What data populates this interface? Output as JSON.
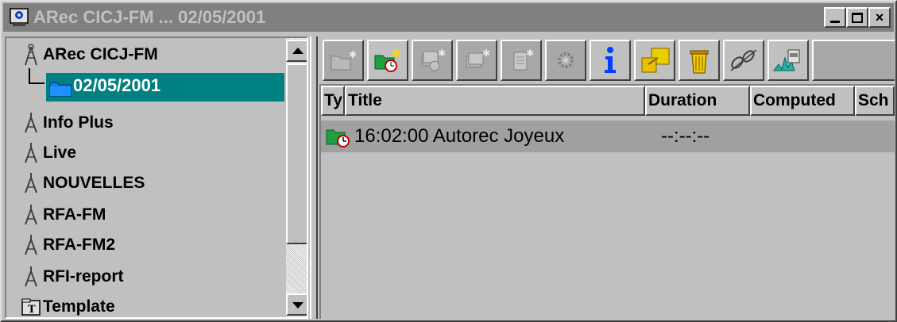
{
  "window": {
    "title": "ARec CICJ-FM ... 02/05/2001",
    "controls": {
      "minimize": "_",
      "maximize": "□",
      "close": "×"
    }
  },
  "tree": {
    "root": {
      "label": "ARec CICJ-FM",
      "icon": "antenna-icon"
    },
    "selected_child": {
      "label": "02/05/2001",
      "icon": "folder-icon"
    },
    "items": [
      {
        "label": "Info Plus",
        "icon": "antenna-icon"
      },
      {
        "label": "Live",
        "icon": "antenna-icon"
      },
      {
        "label": "NOUVELLES",
        "icon": "antenna-icon"
      },
      {
        "label": "RFA-FM",
        "icon": "antenna-icon"
      },
      {
        "label": "RFA-FM2",
        "icon": "antenna-icon"
      },
      {
        "label": "RFI-report",
        "icon": "antenna-icon"
      },
      {
        "label": "Template",
        "icon": "template-icon"
      }
    ]
  },
  "toolbar": {
    "buttons": [
      {
        "name": "new-folder",
        "icon": "new-folder-icon"
      },
      {
        "name": "new-scheduled-folder",
        "icon": "new-scheduled-folder-icon"
      },
      {
        "name": "new-scheduled-item",
        "icon": "new-scheduled-item-icon"
      },
      {
        "name": "new-item",
        "icon": "new-item-icon"
      },
      {
        "name": "new-document",
        "icon": "new-document-icon"
      },
      {
        "name": "settings",
        "icon": "gear-icon"
      },
      {
        "name": "info",
        "icon": "info-icon"
      },
      {
        "name": "move",
        "icon": "move-icon"
      },
      {
        "name": "delete",
        "icon": "trash-icon"
      },
      {
        "name": "link",
        "icon": "link-icon"
      },
      {
        "name": "audio-edit",
        "icon": "waveform-icon"
      }
    ]
  },
  "list": {
    "columns": [
      "Ty",
      "Title",
      "Duration",
      "Computed",
      "Sch"
    ],
    "rows": [
      {
        "title": "16:02:00 Autorec Joyeux",
        "duration": "--:--:--",
        "icon": "scheduled-folder-icon"
      }
    ]
  },
  "colors": {
    "selection": "#008080",
    "titlebar_inactive": "#808080",
    "folder_blue": "#1080e8",
    "folder_green": "#20a040"
  }
}
